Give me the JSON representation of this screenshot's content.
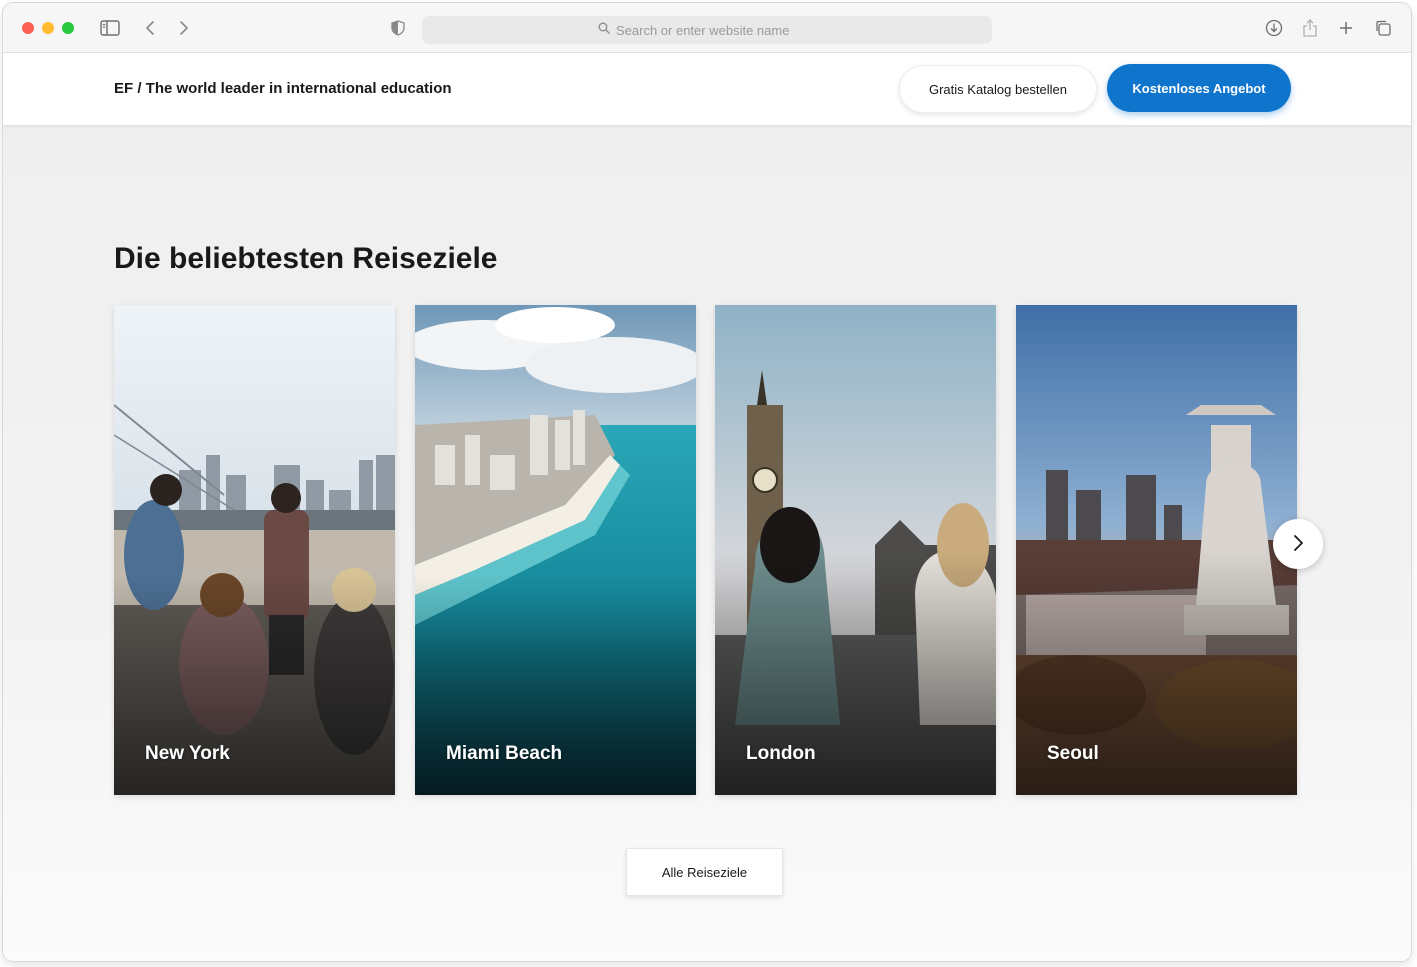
{
  "browser": {
    "address_placeholder": "Search or enter website name",
    "icons": [
      "sidebar-icon",
      "back-icon",
      "forward-icon",
      "privacy-shield-icon",
      "search-icon",
      "download-icon",
      "share-icon",
      "new-tab-icon",
      "tabs-overview-icon"
    ]
  },
  "header": {
    "brand": "EF / The world leader in international education",
    "catalog_button": "Gratis Katalog bestellen",
    "offer_button": "Kostenloses Angebot",
    "accent_color": "#0f74cc"
  },
  "destinations": {
    "title": "Die beliebtesten Reiseziele",
    "cards": [
      {
        "label": "New York"
      },
      {
        "label": "Miami Beach"
      },
      {
        "label": "London"
      },
      {
        "label": "Seoul"
      }
    ],
    "all_button": "Alle Reiseziele",
    "next_icon": "chevron-right-icon"
  }
}
